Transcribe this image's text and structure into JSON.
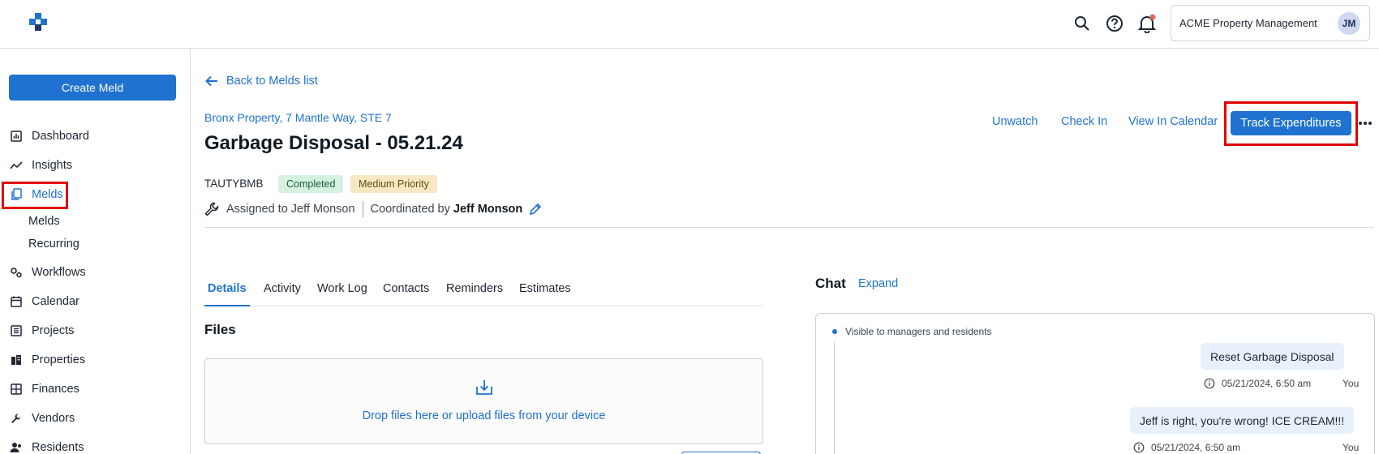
{
  "topbar": {
    "org_name": "ACME Property Management",
    "avatar_initials": "JM",
    "notification_color": "#e3675f"
  },
  "sidebar": {
    "create_label": "Create Meld",
    "items": [
      {
        "label": "Dashboard",
        "icon": "dashboard-icon"
      },
      {
        "label": "Insights",
        "icon": "insights-icon"
      },
      {
        "label": "Melds",
        "icon": "melds-icon",
        "active": true
      },
      {
        "label": "Workflows",
        "icon": "workflows-icon"
      },
      {
        "label": "Calendar",
        "icon": "calendar-icon"
      },
      {
        "label": "Projects",
        "icon": "projects-icon"
      },
      {
        "label": "Properties",
        "icon": "properties-icon"
      },
      {
        "label": "Finances",
        "icon": "finances-icon"
      },
      {
        "label": "Vendors",
        "icon": "vendors-icon"
      },
      {
        "label": "Residents",
        "icon": "residents-icon"
      }
    ],
    "melds_sub": [
      "Melds",
      "Recurring"
    ]
  },
  "meld": {
    "back_label": "Back to Melds list",
    "property": "Bronx Property, 7 Mantle Way, STE 7",
    "title": "Garbage Disposal - 05.21.24",
    "id": "TAUTYBMB",
    "status": "Completed",
    "priority": "Medium Priority",
    "assigned": "Assigned to Jeff Monson",
    "coordinated_label": "Coordinated by",
    "coordinator": "Jeff Monson"
  },
  "actions": {
    "unwatch": "Unwatch",
    "check_in": "Check In",
    "view_calendar": "View In Calendar",
    "track": "Track Expenditures"
  },
  "tabs": [
    "Details",
    "Activity",
    "Work Log",
    "Contacts",
    "Reminders",
    "Estimates"
  ],
  "files": {
    "heading": "Files",
    "drop_text": "Drop files here or upload files from your device"
  },
  "chat": {
    "heading": "Chat",
    "expand": "Expand",
    "visibility": "Visible to managers and residents",
    "messages": [
      {
        "text": "Reset Garbage Disposal",
        "time": "05/21/2024, 6:50 am",
        "author": "You"
      },
      {
        "text": "Jeff is right, you're wrong! ICE CREAM!!!",
        "time": "05/21/2024, 6:50 am",
        "author": "You"
      }
    ]
  },
  "colors": {
    "primary": "#1f72cf",
    "highlight": "#e20000",
    "completed_bg": "#d5f2e1",
    "priority_bg": "#f6e8c2"
  }
}
